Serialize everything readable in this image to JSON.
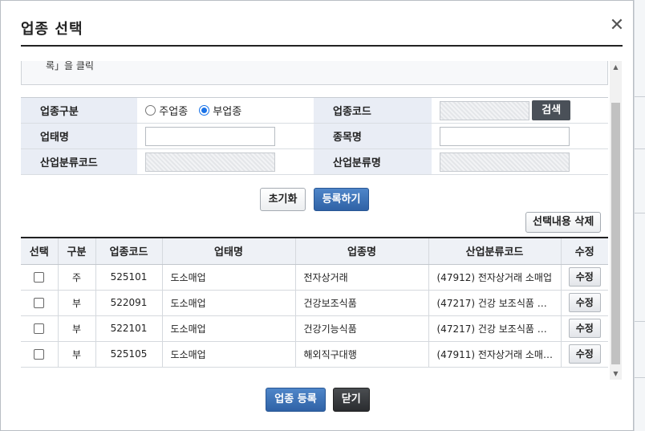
{
  "dialog": {
    "title": "업종 선택",
    "close_icon": "close-icon"
  },
  "note": {
    "text": "록」을 클릭"
  },
  "form": {
    "business_type_label": "업종구분",
    "main_radio_label": "주업종",
    "sub_radio_label": "부업종",
    "selected_radio": "부업종",
    "business_code_label": "업종코드",
    "search_button": "검색",
    "business_form_label": "업태명",
    "item_name_label": "종목명",
    "industry_code_label": "산업분류코드",
    "industry_name_label": "산업분류명",
    "business_form_value": "",
    "item_name_value": ""
  },
  "actions": {
    "reset_label": "초기화",
    "register_label": "등록하기",
    "delete_selected_label": "선택내용 삭제"
  },
  "grid": {
    "headers": [
      "선택",
      "구분",
      "업종코드",
      "업태명",
      "업종명",
      "산업분류코드",
      "수정"
    ],
    "rows": [
      {
        "type": "주",
        "code": "525101",
        "form": "도소매업",
        "name": "전자상거래",
        "industry": "(47912) 전자상거래 소매업",
        "edit": "수정"
      },
      {
        "type": "부",
        "code": "522091",
        "form": "도소매업",
        "name": "건강보조식품",
        "industry": "(47217) 건강 보조식품 …",
        "edit": "수정"
      },
      {
        "type": "부",
        "code": "522101",
        "form": "도소매업",
        "name": "건강기능식품",
        "industry": "(47217) 건강 보조식품 …",
        "edit": "수정"
      },
      {
        "type": "부",
        "code": "525105",
        "form": "도소매업",
        "name": "해외직구대행",
        "industry": "(47911) 전자상거래 소매…",
        "edit": "수정"
      }
    ]
  },
  "footer": {
    "register_business_label": "업종 등록",
    "close_label": "닫기"
  },
  "colors": {
    "accent_blue": "#2f62a6",
    "main_type_red": "#d2261e",
    "label_bg": "#e9edf5"
  }
}
